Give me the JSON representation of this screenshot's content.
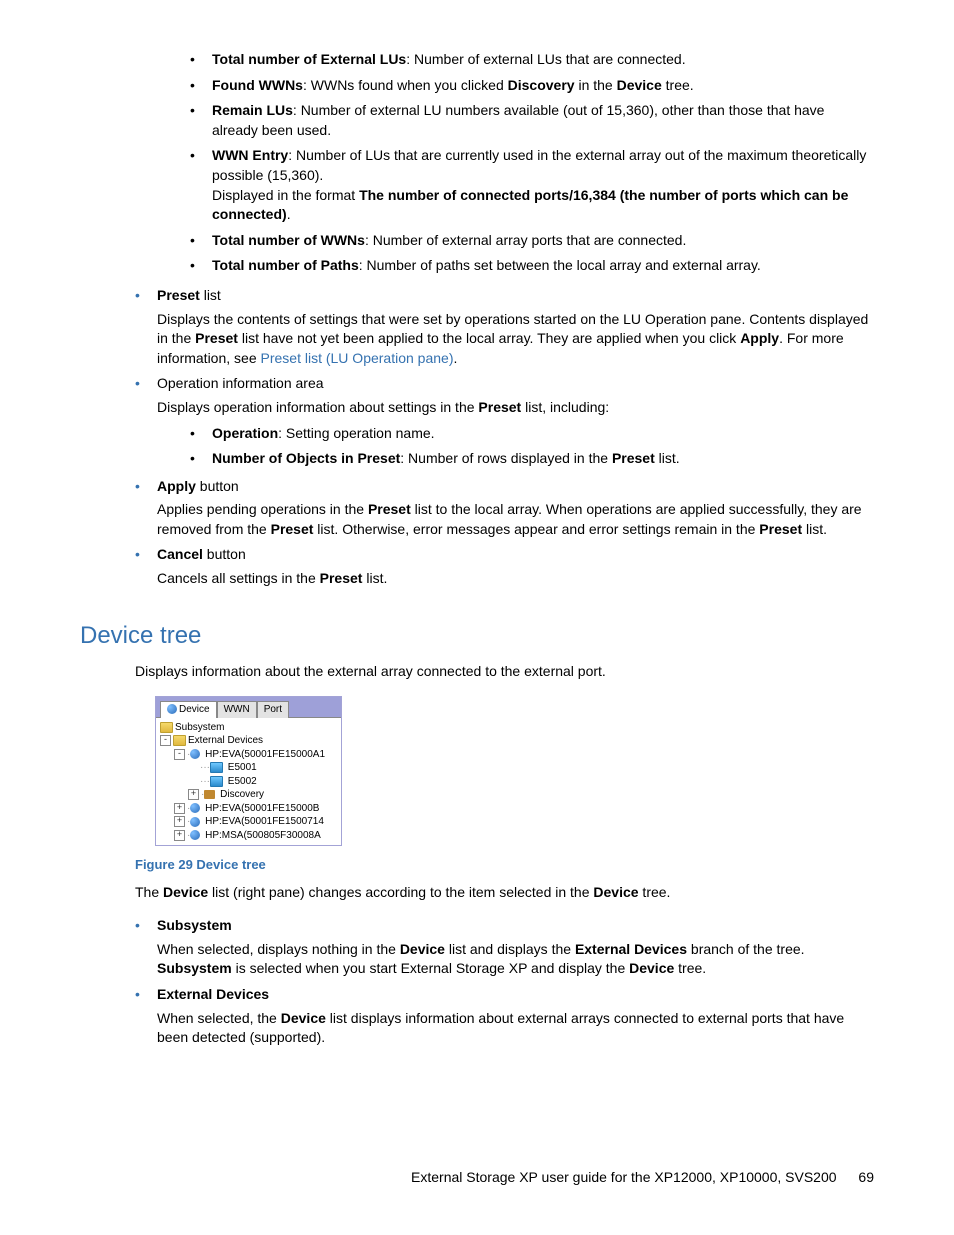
{
  "top_bullets": [
    {
      "label": "Total number of External LUs",
      "desc": ": Number of external LUs that are connected."
    },
    {
      "label": "Found WWNs",
      "desc_parts": [
        ": WWNs found when you clicked ",
        "Discovery",
        " in the ",
        "Device",
        " tree."
      ]
    },
    {
      "label": "Remain LUs",
      "desc": ": Number of external LU numbers available (out of 15,360), other than those that have already been used."
    },
    {
      "label": "WWN Entry",
      "desc": ": Number of LUs that are currently used in the external array out of the maximum theoretically possible (15,360).",
      "extra_prefix": "Displayed in the format ",
      "extra_bold": "The number of connected ports/16,384 (the number of ports which can be connected)",
      "extra_suffix": "."
    },
    {
      "label": "Total number of WWNs",
      "desc": ": Number of external array ports that are connected."
    },
    {
      "label": "Total number of Paths",
      "desc": ": Number of paths set between the local array and external array."
    }
  ],
  "outer": {
    "preset": {
      "title_bold": "Preset",
      "title_rest": " list",
      "para_pre": "Displays the contents of settings that were set by operations started on the LU Operation pane. Contents displayed in the ",
      "para_b1": "Preset",
      "para_mid": " list have not yet been applied to the local array. They are applied when you click ",
      "para_b2": "Apply",
      "para_post": ". For more information, see ",
      "link": "Preset list (LU Operation pane)",
      "tail": "."
    },
    "opinfo": {
      "title": "Operation information area",
      "para_pre": "Displays operation information about settings in the ",
      "para_b": "Preset",
      "para_post": " list, including:",
      "sub": [
        {
          "label": "Operation",
          "desc": ": Setting operation name."
        },
        {
          "label": "Number of Objects in Preset",
          "pre": ": Number of rows displayed in the ",
          "b": "Preset",
          "post": " list."
        }
      ]
    },
    "apply": {
      "title_bold": "Apply",
      "title_rest": " button",
      "s1": "Applies pending operations in the ",
      "b1": "Preset",
      "s2": " list to the local array. When operations are applied successfully, they are removed from the ",
      "b2": "Preset",
      "s3": " list. Otherwise, error messages appear and error settings remain in the ",
      "b3": "Preset",
      "s4": " list."
    },
    "cancel": {
      "title_bold": "Cancel",
      "title_rest": " button",
      "s1": "Cancels all settings in the ",
      "b1": "Preset",
      "s2": " list."
    }
  },
  "heading": "Device tree",
  "intro": "Displays information about the external array connected to the external port.",
  "figure": {
    "tabs": [
      "Device",
      "WWN",
      "Port"
    ],
    "lines": {
      "subsystem": "Subsystem",
      "extdev": "External Devices",
      "dev1": "HP:EVA(50001FE15000A1",
      "e1": "E5001",
      "e2": "E5002",
      "disc": "Discovery",
      "dev2": "HP:EVA(50001FE15000B",
      "dev3": "HP:EVA(50001FE1500714",
      "dev4": "HP:MSA(500805F30008A"
    },
    "caption": "Figure 29 Device tree"
  },
  "after_fig": {
    "s1": "The ",
    "b1": "Device",
    "s2": " list (right pane) changes according to the item selected in the ",
    "b2": "Device",
    "s3": " tree."
  },
  "subsystem_item": {
    "title": "Subsystem",
    "s1": "When selected, displays nothing in the ",
    "b1": "Device",
    "s2": " list and displays the ",
    "b2": "External Devices",
    "s3": " branch of the tree. ",
    "b3": "Subsystem",
    "s4": " is selected when you start External Storage XP and display the ",
    "b4": "Device",
    "s5": " tree."
  },
  "extdev_item": {
    "title": "External Devices",
    "s1": "When selected, the ",
    "b1": "Device",
    "s2": " list displays information about external arrays connected to external ports that have been detected (supported)."
  },
  "footer": {
    "text": "External Storage XP user guide for the XP12000, XP10000, SVS200",
    "page": "69"
  }
}
